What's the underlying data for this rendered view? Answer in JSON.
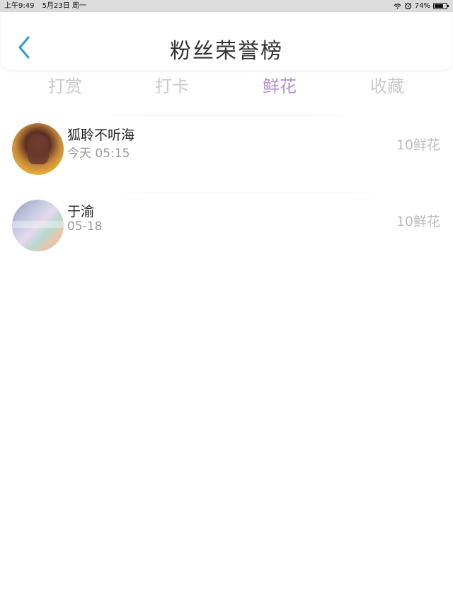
{
  "status_bar": {
    "time": "上午9:49",
    "date": "5月23日 周一",
    "battery": "74%",
    "battery_level": 0.74
  },
  "header": {
    "title": "粉丝荣誉榜",
    "back_icon": "chevron-left-icon",
    "accent_color": "#3a9ad9"
  },
  "tabs": [
    {
      "label": "打赏",
      "active": false
    },
    {
      "label": "打卡",
      "active": false
    },
    {
      "label": "鲜花",
      "active": true
    },
    {
      "label": "收藏",
      "active": false
    }
  ],
  "colors": {
    "active_tab": "#b48fdc",
    "inactive_tab": "#c9c9c9"
  },
  "fans": [
    {
      "name": "狐聆不听海",
      "time": "今天 05:15",
      "amount": "10鲜花"
    },
    {
      "name": "于渝",
      "time": "05-18",
      "amount": "10鲜花"
    }
  ]
}
